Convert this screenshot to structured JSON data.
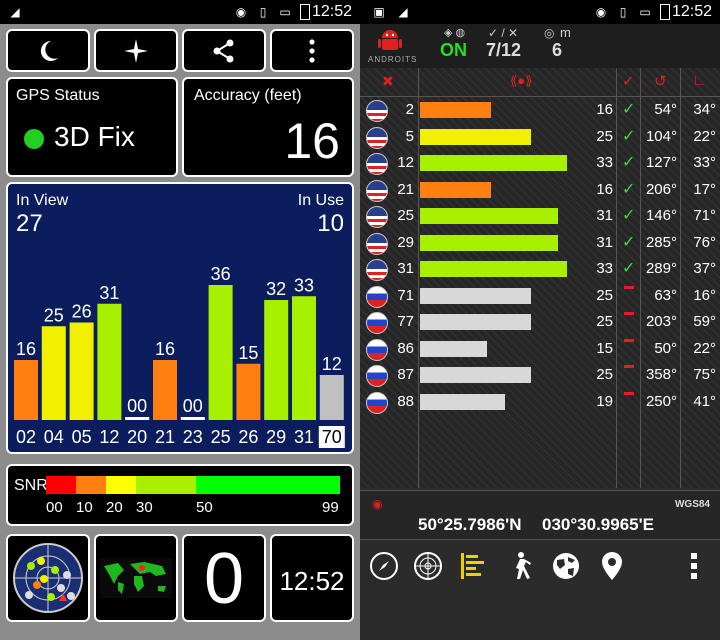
{
  "left": {
    "status_time": "12:52",
    "gps_status": {
      "title": "GPS Status",
      "value": "3D Fix",
      "dot_color": "#22d022"
    },
    "accuracy": {
      "title": "Accuracy (feet)",
      "value": "16"
    },
    "chart": {
      "in_view_label": "In View",
      "in_view": "27",
      "in_use_label": "In Use",
      "in_use": "10",
      "bars": [
        {
          "id": "02",
          "snr": 16,
          "label": "16",
          "color": "#ff7f10"
        },
        {
          "id": "04",
          "snr": 25,
          "label": "25",
          "color": "#f0f000"
        },
        {
          "id": "05",
          "snr": 26,
          "label": "26",
          "color": "#f0f000"
        },
        {
          "id": "12",
          "snr": 31,
          "label": "31",
          "color": "#a8f000"
        },
        {
          "id": "20",
          "snr": 0,
          "label": "00",
          "color": "#ffffff"
        },
        {
          "id": "21",
          "snr": 16,
          "label": "16",
          "color": "#ff7f10"
        },
        {
          "id": "23",
          "snr": 0,
          "label": "00",
          "color": "#ffffff"
        },
        {
          "id": "25",
          "snr": 36,
          "label": "36",
          "color": "#a8f000"
        },
        {
          "id": "26",
          "snr": 15,
          "label": "15",
          "color": "#ff7f10"
        },
        {
          "id": "29",
          "snr": 32,
          "label": "32",
          "color": "#a8f000"
        },
        {
          "id": "31",
          "snr": 33,
          "label": "33",
          "color": "#a8f000"
        },
        {
          "id": "70",
          "snr": 12,
          "label": "12",
          "color": "#c0c0c0",
          "highlight": true
        }
      ],
      "ylim": [
        0,
        40
      ]
    },
    "snr": {
      "label": "SNR",
      "ticks": [
        "00",
        "10",
        "20",
        "30",
        "50",
        "99"
      ],
      "colors": [
        "#ff0000",
        "#ff7f10",
        "#ffff00",
        "#a8f000",
        "#00ff00"
      ]
    },
    "speed": "0",
    "clock": "12:52"
  },
  "right": {
    "status_time": "12:52",
    "brand": "ANDROITS",
    "gps_on": "ON",
    "used_ratio": "7/12",
    "meters": "6",
    "meters_unit": "m",
    "rows": [
      {
        "flag": "us",
        "prn": "2",
        "snr": 16,
        "snr_text": "16",
        "used": true,
        "azimuth": "54°",
        "elevation": "34°",
        "color": "#ff7f10"
      },
      {
        "flag": "us",
        "prn": "5",
        "snr": 25,
        "snr_text": "25",
        "used": true,
        "azimuth": "104°",
        "elevation": "22°",
        "color": "#f0f000"
      },
      {
        "flag": "us",
        "prn": "12",
        "snr": 33,
        "snr_text": "33",
        "used": true,
        "azimuth": "127°",
        "elevation": "33°",
        "color": "#a8f000"
      },
      {
        "flag": "us",
        "prn": "21",
        "snr": 16,
        "snr_text": "16",
        "used": true,
        "azimuth": "206°",
        "elevation": "17°",
        "color": "#ff7f10"
      },
      {
        "flag": "us",
        "prn": "25",
        "snr": 31,
        "snr_text": "31",
        "used": true,
        "azimuth": "146°",
        "elevation": "71°",
        "color": "#a8f000"
      },
      {
        "flag": "us",
        "prn": "29",
        "snr": 31,
        "snr_text": "31",
        "used": true,
        "azimuth": "285°",
        "elevation": "76°",
        "color": "#a8f000"
      },
      {
        "flag": "us",
        "prn": "31",
        "snr": 33,
        "snr_text": "33",
        "used": true,
        "azimuth": "289°",
        "elevation": "37°",
        "color": "#a8f000"
      },
      {
        "flag": "ru",
        "prn": "71",
        "snr": 25,
        "snr_text": "25",
        "used": false,
        "azimuth": "63°",
        "elevation": "16°",
        "color": "#d8d8d8"
      },
      {
        "flag": "ru",
        "prn": "77",
        "snr": 25,
        "snr_text": "25",
        "used": false,
        "azimuth": "203°",
        "elevation": "59°",
        "color": "#d8d8d8"
      },
      {
        "flag": "ru",
        "prn": "86",
        "snr": 15,
        "snr_text": "15",
        "used": false,
        "azimuth": "50°",
        "elevation": "22°",
        "color": "#d8d8d8"
      },
      {
        "flag": "ru",
        "prn": "87",
        "snr": 25,
        "snr_text": "25",
        "used": false,
        "azimuth": "358°",
        "elevation": "75°",
        "color": "#d8d8d8"
      },
      {
        "flag": "ru",
        "prn": "88",
        "snr": 19,
        "snr_text": "19",
        "used": false,
        "azimuth": "250°",
        "elevation": "41°",
        "color": "#d8d8d8"
      }
    ],
    "snr_max": 40,
    "datum": "WGS84",
    "lat": "50°25.7986'N",
    "lon": "030°30.9965'E"
  }
}
